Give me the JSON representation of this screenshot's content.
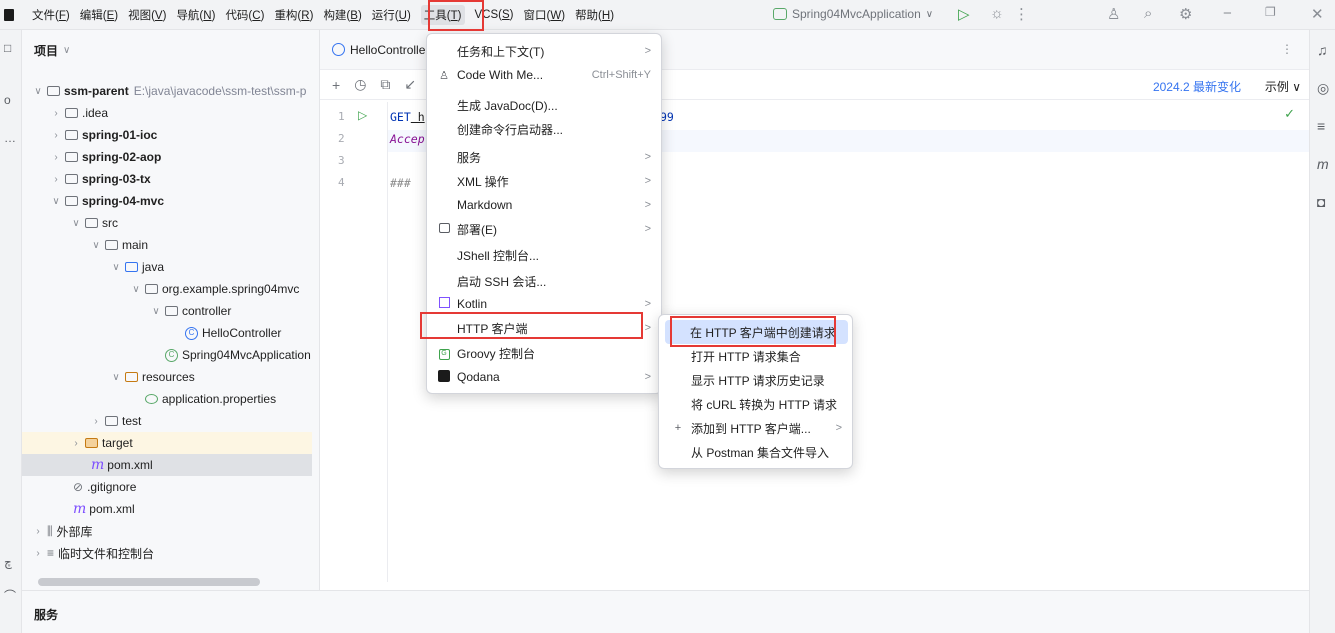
{
  "menubar": {
    "items": [
      {
        "label": "文件(",
        "key": "F",
        "end": ")"
      },
      {
        "label": "编辑(",
        "key": "E",
        "end": ")"
      },
      {
        "label": "视图(",
        "key": "V",
        "end": ")"
      },
      {
        "label": "导航(",
        "key": "N",
        "end": ")"
      },
      {
        "label": "代码(",
        "key": "C",
        "end": ")"
      },
      {
        "label": "重构(",
        "key": "R",
        "end": ")"
      },
      {
        "label": "构建(",
        "key": "B",
        "end": ")"
      },
      {
        "label": "运行(",
        "key": "U",
        "end": ")"
      },
      {
        "label": "工具(",
        "key": "T",
        "end": ")"
      },
      {
        "label": "VCS(",
        "key": "S",
        "end": ")"
      },
      {
        "label": "窗口(",
        "key": "W",
        "end": ")"
      },
      {
        "label": "帮助(",
        "key": "H",
        "end": ")"
      }
    ],
    "run_config": "Spring04MvcApplication",
    "run_config_chevron": "∨"
  },
  "project": {
    "title": "项目",
    "chevron": "∨"
  },
  "tree": {
    "root": {
      "name": "ssm-parent",
      "path": "E:\\java\\javacode\\ssm-test\\ssm-p"
    },
    "idea": ".idea",
    "m1": "spring-01-ioc",
    "m2": "spring-02-aop",
    "m3": "spring-03-tx",
    "m4": "spring-04-mvc",
    "src": "src",
    "main": "main",
    "java": "java",
    "pkg": "org.example.spring04mvc",
    "controller": "controller",
    "hello": "HelloController",
    "app": "Spring04MvcApplication",
    "resources": "resources",
    "props": "application.properties",
    "test": "test",
    "target": "target",
    "pom_inner": "pom.xml",
    "gitignore": ".gitignore",
    "pom_outer": "pom.xml",
    "ext_libs": "外部库",
    "scratches": "临时文件和控制台"
  },
  "editor": {
    "tab": "HelloControlle",
    "latest_changes": "2024.2 最新变化",
    "examples": "示例 ∨",
    "lines": [
      "1",
      "2",
      "3",
      "4"
    ],
    "code_line1_kw": "GET",
    "code_line1_rest": " h",
    "code_line1_tail": "99",
    "code_line2": "Accep",
    "code_line4": "###"
  },
  "tools_menu": {
    "items": [
      {
        "label": "任务和上下文(T)",
        "sub": ">"
      },
      {
        "label": "Code With Me...",
        "shortcut": "Ctrl+Shift+Y"
      },
      {
        "label": "生成 JavaDoc(D)..."
      },
      {
        "label": "创建命令行启动器..."
      },
      {
        "label": "服务",
        "sub": ">"
      },
      {
        "label": "XML 操作",
        "sub": ">"
      },
      {
        "label": "Markdown",
        "sub": ">"
      },
      {
        "label": "部署(E)",
        "sub": ">"
      },
      {
        "label": "JShell 控制台..."
      },
      {
        "label": "启动 SSH 会话..."
      },
      {
        "label": "Kotlin",
        "sub": ">"
      },
      {
        "label": "HTTP 客户端",
        "sub": ">"
      },
      {
        "label": "Groovy 控制台"
      },
      {
        "label": "Qodana",
        "sub": ">"
      }
    ]
  },
  "http_submenu": {
    "items": [
      {
        "label": "在 HTTP 客户端中创建请求"
      },
      {
        "label": "打开 HTTP 请求集合"
      },
      {
        "label": "显示 HTTP 请求历史记录"
      },
      {
        "label": "将 cURL 转换为 HTTP 请求"
      },
      {
        "label": "添加到 HTTP 客户端...",
        "sub": ">"
      },
      {
        "label": "从 Postman 集合文件导入"
      }
    ]
  },
  "bottom_panel": {
    "title": "服务"
  },
  "colors": {
    "accent": "#3574f0",
    "highlight_box": "#e53935",
    "menu_hover": "#d4e2ff"
  }
}
